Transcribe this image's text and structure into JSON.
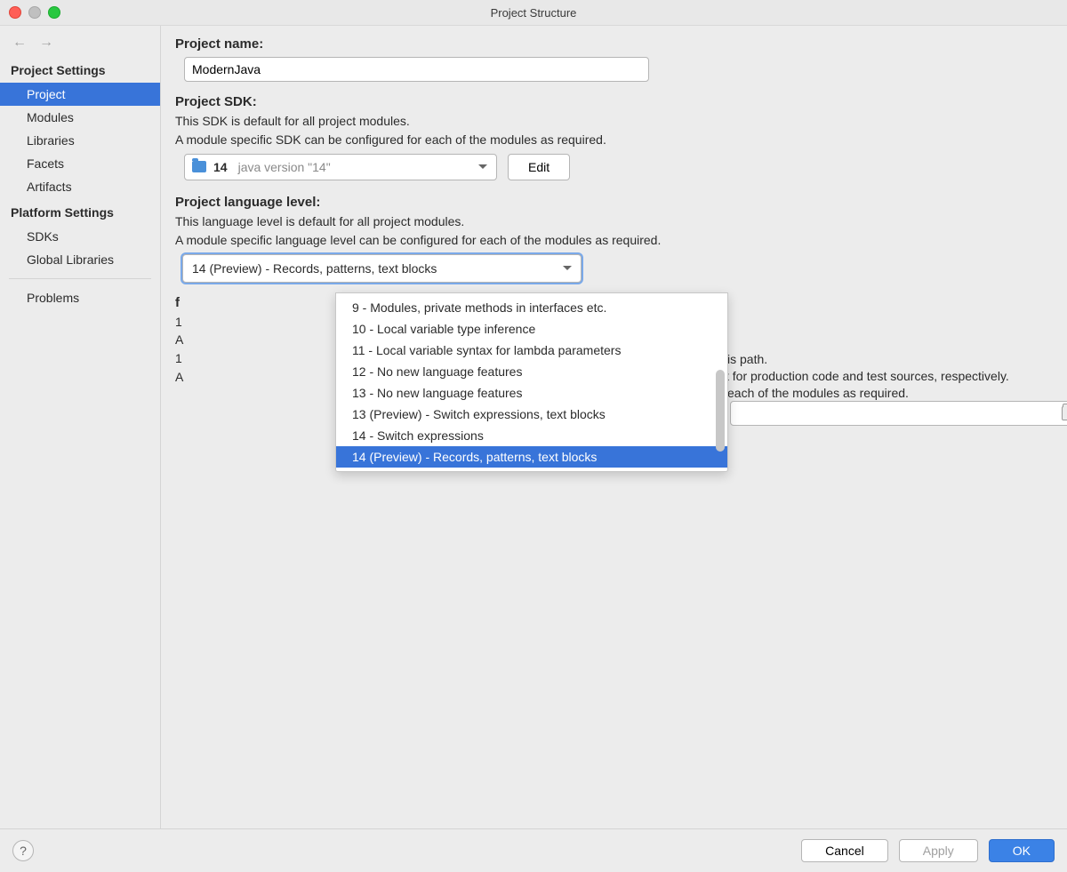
{
  "title": "Project Structure",
  "sidebar": {
    "sections": [
      {
        "header": "Project Settings",
        "items": [
          "Project",
          "Modules",
          "Libraries",
          "Facets",
          "Artifacts"
        ],
        "selected_index": 0
      },
      {
        "header": "Platform Settings",
        "items": [
          "SDKs",
          "Global Libraries"
        ]
      }
    ],
    "extra": [
      "Problems"
    ]
  },
  "project_name": {
    "label": "Project name:",
    "value": "ModernJava"
  },
  "project_sdk": {
    "label": "Project SDK:",
    "desc1": "This SDK is default for all project modules.",
    "desc2": "A module specific SDK can be configured for each of the modules as required.",
    "selected_num": "14",
    "selected_detail": "java version \"14\"",
    "edit_label": "Edit"
  },
  "lang_level": {
    "label": "Project language level:",
    "desc1": "This language level is default for all project modules.",
    "desc2": "A module specific language level can be configured for each of the modules as required.",
    "selected": "14 (Preview) - Records, patterns, text blocks",
    "options": [
      "9 - Modules, private methods in interfaces etc.",
      "10 - Local variable type inference",
      "11 - Local variable syntax for lambda parameters",
      "12 - No new language features",
      "13 - No new language features",
      "13 (Preview) - Switch expressions, text blocks",
      "14 - Switch expressions",
      "14 (Preview) - Records, patterns, text blocks"
    ],
    "selected_option_index": 7
  },
  "obscured": {
    "line1_right": "is path.",
    "line2_right": "st for production code and test sources, respectively.",
    "line3_right": "each of the modules as required."
  },
  "footer": {
    "cancel": "Cancel",
    "apply": "Apply",
    "ok": "OK"
  }
}
